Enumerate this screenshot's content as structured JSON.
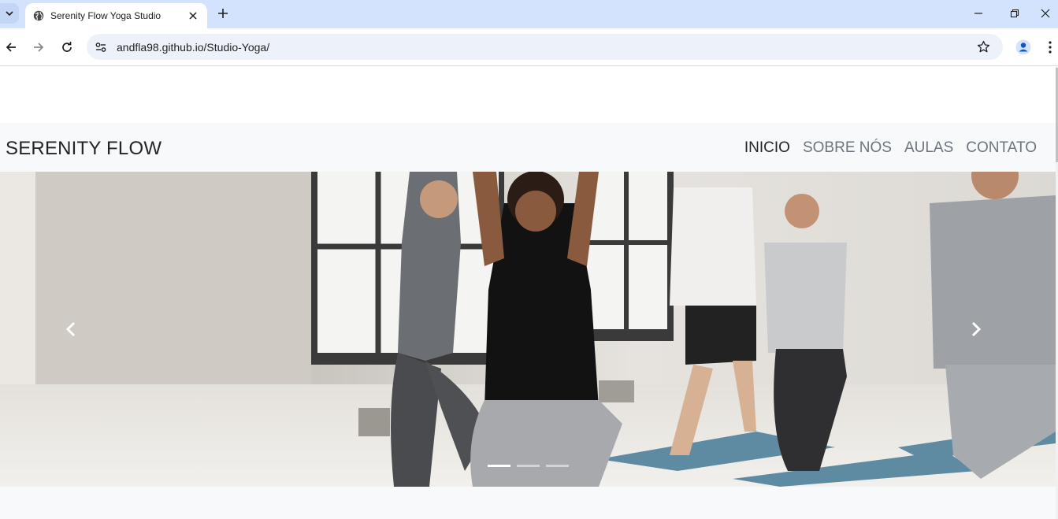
{
  "browser": {
    "tab_title": "Serenity Flow Yoga Studio",
    "url": "andfla98.github.io/Studio-Yoga/"
  },
  "navbar": {
    "brand": "SERENITY FLOW",
    "links": [
      {
        "label": "INICIO",
        "active": true
      },
      {
        "label": "SOBRE NÓS",
        "active": false
      },
      {
        "label": "AULAS",
        "active": false
      },
      {
        "label": "CONTATO",
        "active": false
      }
    ]
  },
  "carousel": {
    "slide_count": 3,
    "active_index": 0,
    "image": "yoga-class-photo"
  },
  "colors": {
    "chrome_bg": "#d3e3fd",
    "omnibox_bg": "#edf2fa",
    "navbar_bg": "#f8f9fa",
    "brand_text": "#212529",
    "link_muted": "#6c757d"
  }
}
